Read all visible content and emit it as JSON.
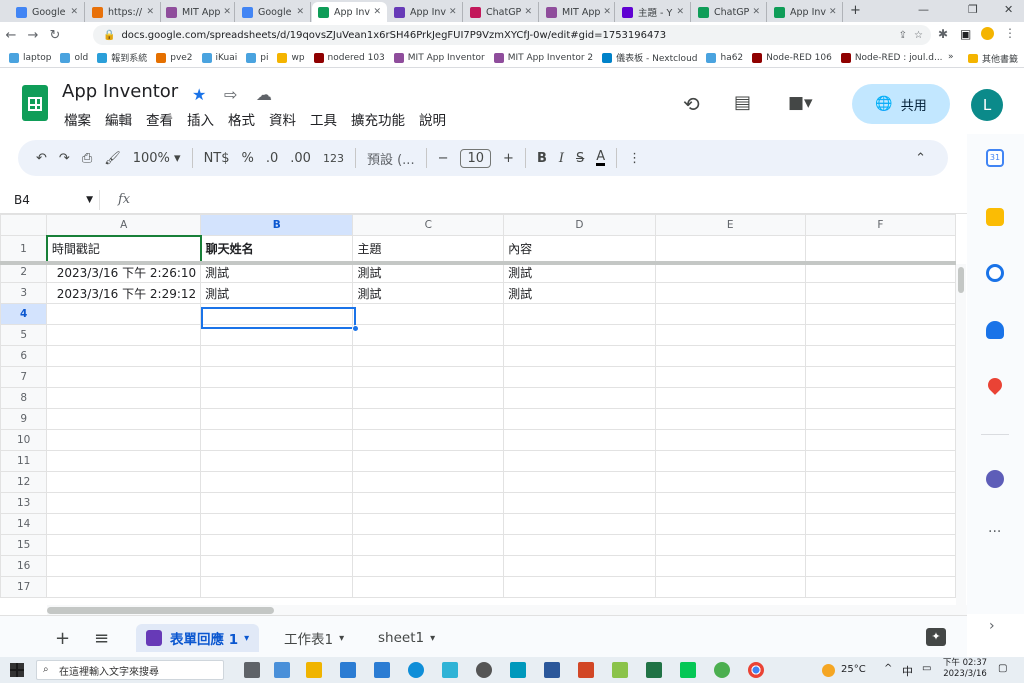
{
  "browser": {
    "tabs": [
      {
        "label": "Google",
        "color": "#4285f4"
      },
      {
        "label": "https://",
        "color": "#e8710a"
      },
      {
        "label": "MIT App",
        "color": "#8f4d9c"
      },
      {
        "label": "Google",
        "color": "#4285f4"
      },
      {
        "label": "App Inv",
        "color": "#0f9d58",
        "active": true
      },
      {
        "label": "App Inv",
        "color": "#673ab7"
      },
      {
        "label": "ChatGP",
        "color": "#c2185b"
      },
      {
        "label": "MIT App",
        "color": "#8f4d9c"
      },
      {
        "label": "主題 - Y",
        "color": "#6001d2"
      },
      {
        "label": "ChatGP",
        "color": "#0f9d58"
      },
      {
        "label": "App Inv",
        "color": "#0f9d58"
      }
    ],
    "new_tab": "+",
    "url": "docs.google.com/spreadsheets/d/19qovsZJuVean1x6rSH46PrkJegFUI7P9VzmXYCfJ-0w/edit#gid=1753196473",
    "bookmarks": [
      {
        "label": "laptop",
        "color": "#4aa3df"
      },
      {
        "label": "old",
        "color": "#4aa3df"
      },
      {
        "label": "報到系統",
        "color": "#2b9fd9"
      },
      {
        "label": "pve2",
        "color": "#e57000"
      },
      {
        "label": "iKuai",
        "color": "#4aa3df"
      },
      {
        "label": "pi",
        "color": "#4aa3df"
      },
      {
        "label": "wp",
        "color": "#f4b400"
      },
      {
        "label": "nodered 103",
        "color": "#8f0000"
      },
      {
        "label": "MIT App Inventor",
        "color": "#8f4d9c"
      },
      {
        "label": "MIT App Inventor 2",
        "color": "#8f4d9c"
      },
      {
        "label": "儀表板 - Nextcloud",
        "color": "#0082c9"
      },
      {
        "label": "ha62",
        "color": "#4aa3df"
      },
      {
        "label": "Node-RED 106",
        "color": "#8f0000"
      },
      {
        "label": "Node-RED : joul.d...",
        "color": "#8f0000"
      }
    ],
    "more_bookmarks": "»",
    "other_bookmarks": "其他書籤"
  },
  "app": {
    "title": "App Inventor",
    "menu": [
      "檔案",
      "編輯",
      "查看",
      "插入",
      "格式",
      "資料",
      "工具",
      "擴充功能",
      "說明"
    ],
    "share_label": "共用",
    "avatar_letter": "L"
  },
  "toolbar": {
    "zoom": "100%",
    "currency": "NT$",
    "percent": "%",
    "dec_less": ".0",
    "dec_more": ".00",
    "number_format": "123",
    "font": "預設 (...",
    "minus": "−",
    "font_size": "10",
    "plus": "+",
    "bold": "B",
    "italic": "I"
  },
  "formula_bar": {
    "cell": "B4",
    "fx": "fx"
  },
  "grid": {
    "columns": [
      "A",
      "B",
      "C",
      "D",
      "E",
      "F"
    ],
    "selected_column": "B",
    "selected_row": "4",
    "rows": [
      {
        "n": "1",
        "cells": [
          "時間戳記",
          "聊天姓名",
          "主題",
          "內容",
          "",
          ""
        ]
      },
      {
        "n": "2",
        "cells": [
          "2023/3/16 下午 2:26:10",
          "測試",
          "測試",
          "測試",
          "",
          ""
        ]
      },
      {
        "n": "3",
        "cells": [
          "2023/3/16 下午 2:29:12",
          "測試",
          "測試",
          "測試",
          "",
          ""
        ]
      },
      {
        "n": "4",
        "cells": [
          "",
          "",
          "",
          "",
          "",
          ""
        ]
      },
      {
        "n": "5",
        "cells": [
          "",
          "",
          "",
          "",
          "",
          ""
        ]
      },
      {
        "n": "6",
        "cells": [
          "",
          "",
          "",
          "",
          "",
          ""
        ]
      },
      {
        "n": "7",
        "cells": [
          "",
          "",
          "",
          "",
          "",
          ""
        ]
      },
      {
        "n": "8",
        "cells": [
          "",
          "",
          "",
          "",
          "",
          ""
        ]
      },
      {
        "n": "9",
        "cells": [
          "",
          "",
          "",
          "",
          "",
          ""
        ]
      },
      {
        "n": "10",
        "cells": [
          "",
          "",
          "",
          "",
          "",
          ""
        ]
      },
      {
        "n": "11",
        "cells": [
          "",
          "",
          "",
          "",
          "",
          ""
        ]
      },
      {
        "n": "12",
        "cells": [
          "",
          "",
          "",
          "",
          "",
          ""
        ]
      },
      {
        "n": "13",
        "cells": [
          "",
          "",
          "",
          "",
          "",
          ""
        ]
      },
      {
        "n": "14",
        "cells": [
          "",
          "",
          "",
          "",
          "",
          ""
        ]
      },
      {
        "n": "15",
        "cells": [
          "",
          "",
          "",
          "",
          "",
          ""
        ]
      },
      {
        "n": "16",
        "cells": [
          "",
          "",
          "",
          "",
          "",
          ""
        ]
      },
      {
        "n": "17",
        "cells": [
          "",
          "",
          "",
          "",
          "",
          ""
        ]
      }
    ]
  },
  "sheets": {
    "add": "+",
    "list": "≡",
    "tabs": [
      {
        "label": "表單回應 1",
        "active": true
      },
      {
        "label": "工作表1"
      },
      {
        "label": "sheet1"
      }
    ]
  },
  "right_panel": {
    "calendar_day": "31"
  },
  "taskbar": {
    "search_placeholder": "在這裡輸入文字來搜尋",
    "weather": "25°C",
    "ime": "中",
    "time": "下午 02:37",
    "date": "2023/3/16"
  }
}
